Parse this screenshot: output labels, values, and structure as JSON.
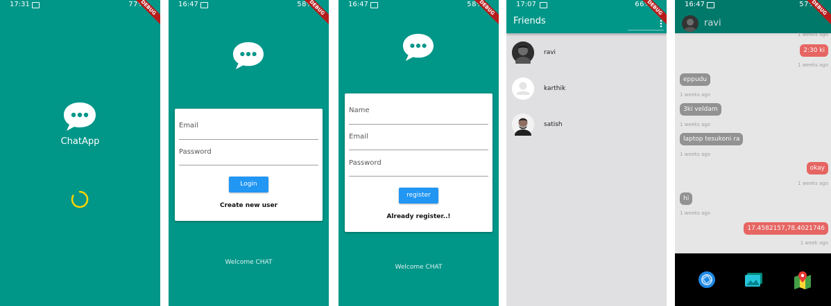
{
  "screens": {
    "splash": {
      "status_time": "17:31",
      "status_right": "77%",
      "app_name": "ChatApp",
      "debug_label": "DEBUG"
    },
    "login": {
      "status_time": "16:47",
      "status_right": "58%",
      "email_placeholder": "Email",
      "password_placeholder": "Password",
      "login_button": "Login",
      "create_link": "Create new user",
      "welcome_text": "Welcome CHAT",
      "debug_label": "DEBUG"
    },
    "register": {
      "status_time": "16:47",
      "status_right": "58%",
      "name_placeholder": "Name",
      "email_placeholder": "Email",
      "password_placeholder": "Password",
      "register_button": "register",
      "already_link": "Already register..!",
      "welcome_text": "Welcome CHAT",
      "debug_label": "DEBUG"
    },
    "friends": {
      "status_time": "17:07",
      "status_right": "66%",
      "title": "Friends",
      "menu_icon": "more-vert-icon",
      "items": [
        {
          "name": "ravi",
          "avatar": "photo-dark"
        },
        {
          "name": "karthik",
          "avatar": "default-person"
        },
        {
          "name": "satish",
          "avatar": "photo-bearded"
        }
      ],
      "debug_label": "DEBUG"
    },
    "chat": {
      "status_time": "16:47",
      "status_right": "57%",
      "contact_name": "ravi",
      "top_timestamp": "1 weeks ago",
      "messages": [
        {
          "text": "2:30 ki",
          "sender": "me",
          "time": "1 weeks ago"
        },
        {
          "text": "eppudu",
          "sender": "them",
          "time": "1 weeks ago"
        },
        {
          "text": "3ki veldam",
          "sender": "them",
          "time": "1 weeks ago"
        },
        {
          "text": "laptop tesukoni ra",
          "sender": "them",
          "time": "1 weeks ago"
        },
        {
          "text": "okay",
          "sender": "me",
          "time": "1 weeks ago"
        },
        {
          "text": "hi",
          "sender": "them",
          "time": "1 weeks ago"
        },
        {
          "text": "17.4582157,78.4021746",
          "sender": "me",
          "time": "1 week ago"
        }
      ],
      "attach_options": [
        "camera-icon",
        "gallery-icon",
        "location-icon"
      ],
      "debug_label": "DEBUG"
    }
  },
  "colors": {
    "primary": "#009688",
    "button": "#2196f3",
    "my_bubble": "#e53935",
    "their_bubble": "#757575",
    "spinner": "#ffd600",
    "debug_banner": "#b71c1c"
  }
}
